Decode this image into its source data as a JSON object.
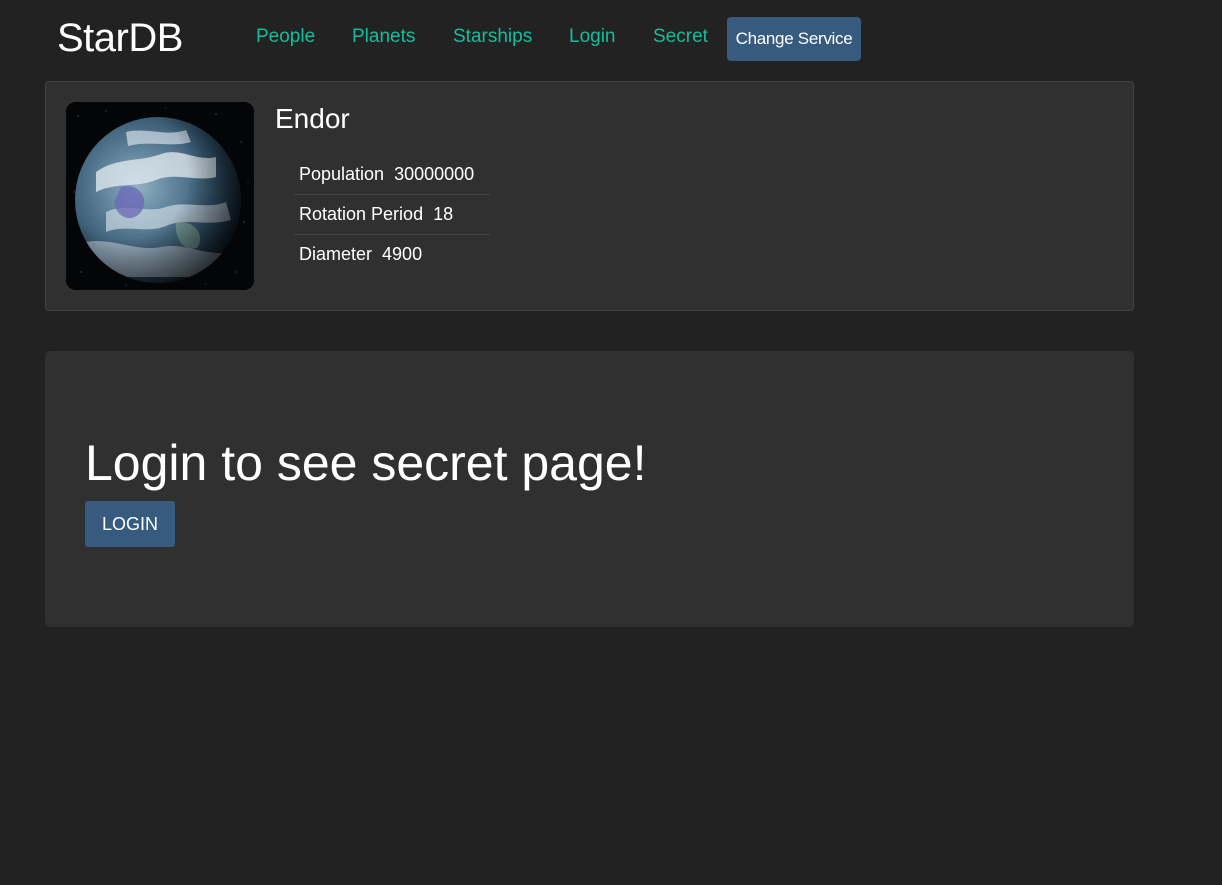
{
  "header": {
    "brand": "StarDB",
    "nav": [
      {
        "label": "People"
      },
      {
        "label": "Planets"
      },
      {
        "label": "Starships"
      },
      {
        "label": "Login"
      },
      {
        "label": "Secret"
      }
    ],
    "change_service_label": "Change Service"
  },
  "planet": {
    "name": "Endor",
    "image_icon": "planet-image",
    "properties": [
      {
        "label": "Population",
        "value": "30000000"
      },
      {
        "label": "Rotation Period",
        "value": "18"
      },
      {
        "label": "Diameter",
        "value": "4900"
      }
    ]
  },
  "secret": {
    "title": "Login to see secret page!",
    "login_label": "LOGIN"
  },
  "colors": {
    "background": "#222222",
    "card": "#303030",
    "nav_link": "#18bc9c",
    "button": "#375a7f",
    "text": "#ffffff"
  }
}
